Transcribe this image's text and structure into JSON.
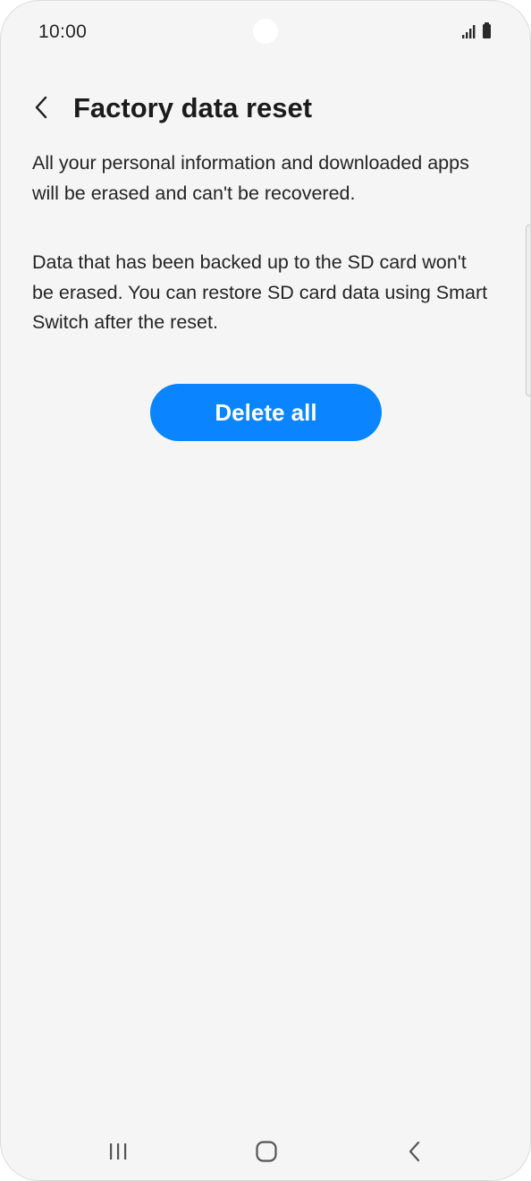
{
  "status_bar": {
    "time": "10:00",
    "icons": [
      "signal-icon",
      "battery-icon"
    ]
  },
  "header": {
    "back_icon": "chevron-left-icon",
    "title": "Factory data reset"
  },
  "content": {
    "paragraph_1": "All your personal information and downloaded apps will be erased and can't be recovered.",
    "paragraph_2": "Data that has been backed up to the SD card won't be erased. You can restore SD card data using Smart Switch after the reset."
  },
  "actions": {
    "delete_all_label": "Delete all"
  },
  "nav_bar": {
    "items": [
      "recent-apps-icon",
      "home-icon",
      "back-icon"
    ]
  },
  "colors": {
    "background": "#f5f5f5",
    "accent": "#0a84ff",
    "text": "#242424"
  }
}
